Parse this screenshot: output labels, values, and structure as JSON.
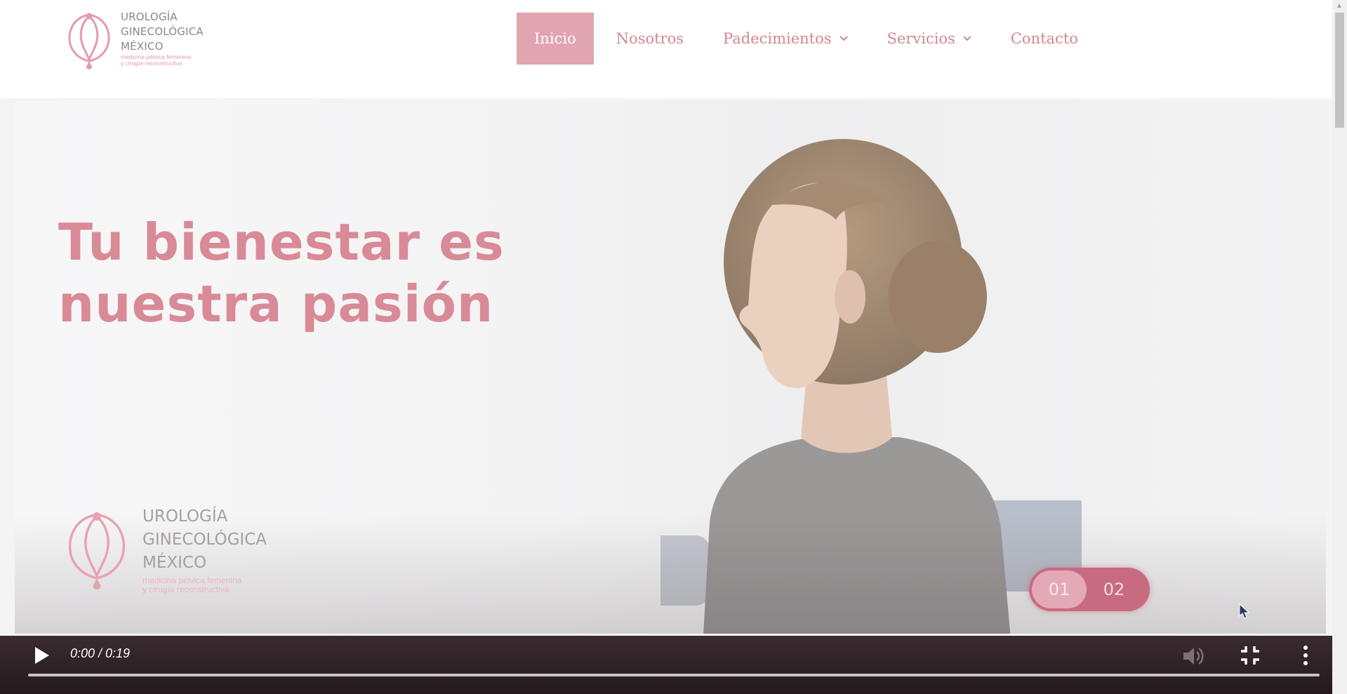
{
  "header": {
    "logo": {
      "lines": [
        "UROLOGÍA",
        "GINECOLÓGICA",
        "MÉXICO"
      ],
      "tagline": [
        "medicina pélvica femenina",
        "y cirugía reconstructiva"
      ]
    },
    "nav": [
      {
        "label": "Inicio",
        "active": true
      },
      {
        "label": "Nosotros"
      },
      {
        "label": "Padecimientos",
        "has_dropdown": true
      },
      {
        "label": "Servicios",
        "has_dropdown": true
      },
      {
        "label": "Contacto"
      }
    ]
  },
  "hero": {
    "heading_line1": "Tu bienestar es",
    "heading_line2": "nuestra pasión",
    "logo": {
      "lines": [
        "UROLOGÍA",
        "GINECOLÓGICA",
        "MÉXICO"
      ],
      "tagline": [
        "medicina pélvica femenina",
        "y cirugía reconstructiva"
      ]
    },
    "slides": [
      "01",
      "02"
    ],
    "active_slide": "01"
  },
  "video": {
    "time": "0:00 / 0:19",
    "progress": 0,
    "icons": [
      "play-icon",
      "volume-icon",
      "exit-fullscreen-icon",
      "more-options-icon"
    ]
  },
  "colors": {
    "brand_pink": "#d98a97",
    "nav_active_bg": "#e0a5b0",
    "slide_pill": "#c86b80",
    "video_bar": "#2d2125"
  }
}
